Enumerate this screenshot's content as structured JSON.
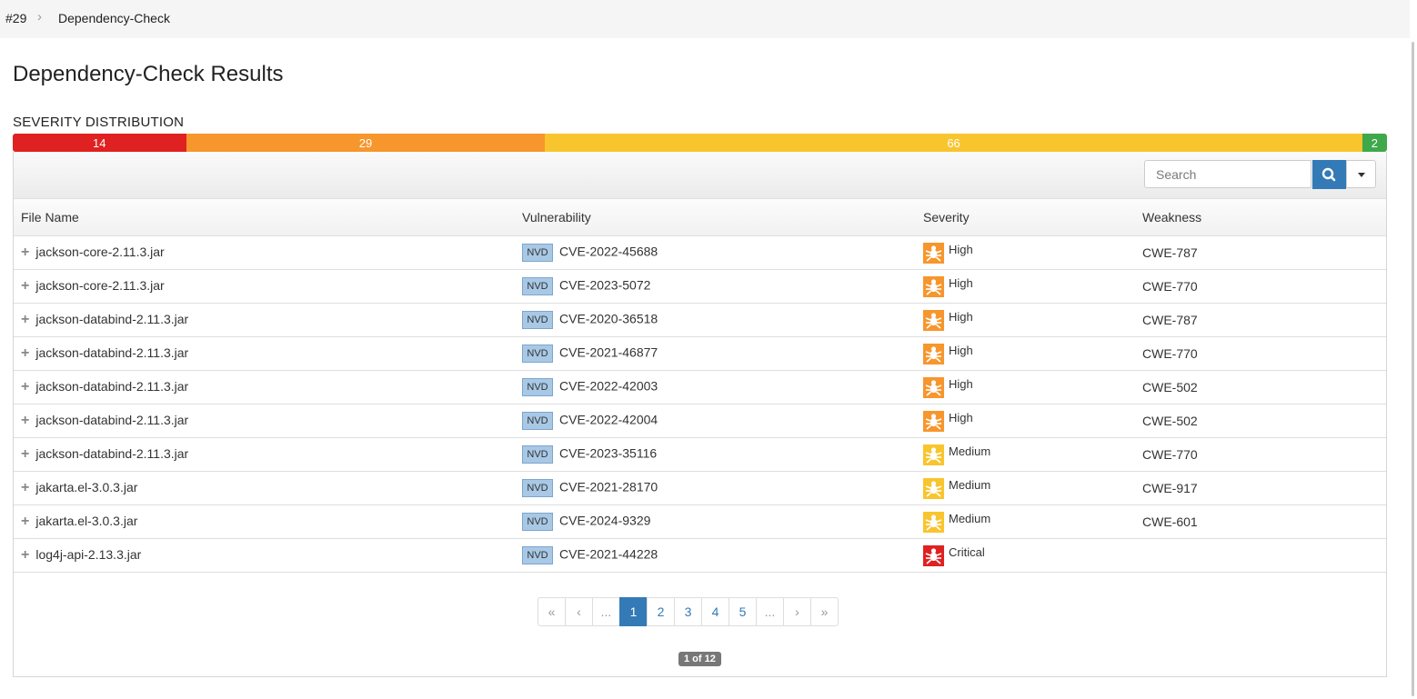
{
  "breadcrumb": {
    "build": "#29",
    "separator": "›",
    "page": "Dependency-Check"
  },
  "title": "Dependency-Check Results",
  "severity_distribution": {
    "label": "SEVERITY DISTRIBUTION",
    "segments": [
      {
        "count": "14",
        "value": 14,
        "color": "#e02121"
      },
      {
        "count": "29",
        "value": 29,
        "color": "#f7962d"
      },
      {
        "count": "66",
        "value": 66,
        "color": "#f9c52e"
      },
      {
        "count": "2",
        "value": 2,
        "color": "#3fa84a"
      }
    ]
  },
  "search": {
    "placeholder": "Search"
  },
  "table": {
    "headers": [
      "File Name",
      "Vulnerability",
      "Severity",
      "Weakness"
    ],
    "rows": [
      {
        "file": "jackson-core-2.11.3.jar",
        "source": "NVD",
        "cve": "CVE-2022-45688",
        "severity": "High",
        "weakness": "CWE-787"
      },
      {
        "file": "jackson-core-2.11.3.jar",
        "source": "NVD",
        "cve": "CVE-2023-5072",
        "severity": "High",
        "weakness": "CWE-770"
      },
      {
        "file": "jackson-databind-2.11.3.jar",
        "source": "NVD",
        "cve": "CVE-2020-36518",
        "severity": "High",
        "weakness": "CWE-787"
      },
      {
        "file": "jackson-databind-2.11.3.jar",
        "source": "NVD",
        "cve": "CVE-2021-46877",
        "severity": "High",
        "weakness": "CWE-770"
      },
      {
        "file": "jackson-databind-2.11.3.jar",
        "source": "NVD",
        "cve": "CVE-2022-42003",
        "severity": "High",
        "weakness": "CWE-502"
      },
      {
        "file": "jackson-databind-2.11.3.jar",
        "source": "NVD",
        "cve": "CVE-2022-42004",
        "severity": "High",
        "weakness": "CWE-502"
      },
      {
        "file": "jackson-databind-2.11.3.jar",
        "source": "NVD",
        "cve": "CVE-2023-35116",
        "severity": "Medium",
        "weakness": "CWE-770"
      },
      {
        "file": "jakarta.el-3.0.3.jar",
        "source": "NVD",
        "cve": "CVE-2021-28170",
        "severity": "Medium",
        "weakness": "CWE-917"
      },
      {
        "file": "jakarta.el-3.0.3.jar",
        "source": "NVD",
        "cve": "CVE-2024-9329",
        "severity": "Medium",
        "weakness": "CWE-601"
      },
      {
        "file": "log4j-api-2.13.3.jar",
        "source": "NVD",
        "cve": "CVE-2021-44228",
        "severity": "Critical",
        "weakness": ""
      }
    ]
  },
  "severity_colors": {
    "Critical": "#e02121",
    "High": "#f7962d",
    "Medium": "#f9c52e",
    "Low": "#3fa84a"
  },
  "pagination": {
    "items": [
      "«",
      "‹",
      "...",
      "1",
      "2",
      "3",
      "4",
      "5",
      "...",
      "›",
      "»"
    ],
    "active": "1",
    "info": "1 of 12"
  }
}
